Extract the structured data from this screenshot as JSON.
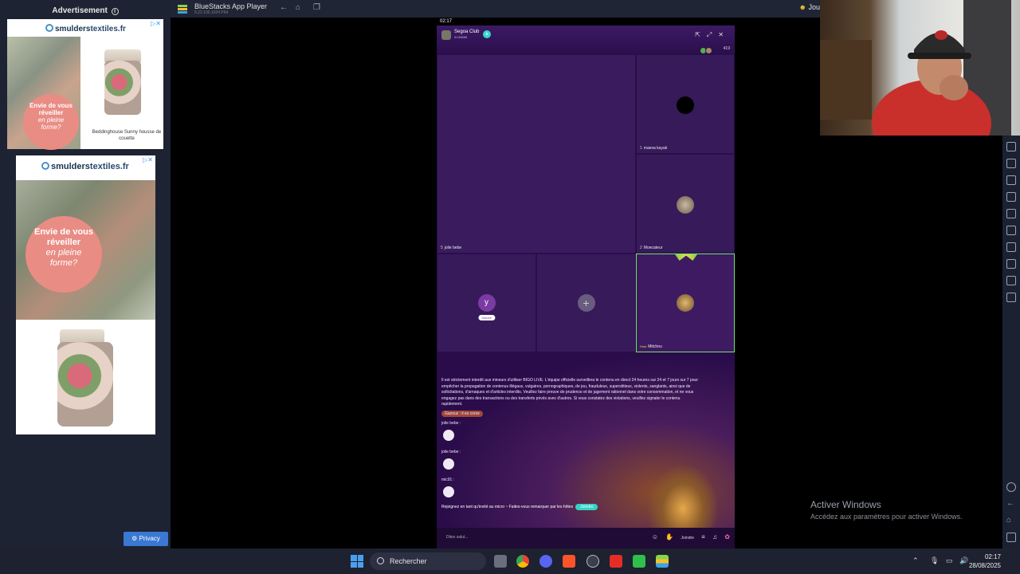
{
  "ads": {
    "title": "Advertisement",
    "ad1": {
      "brand_prefix": "smulders",
      "brand_suffix": "textiles.fr",
      "bubble_line1": "Envie de vous",
      "bubble_line2": "réveiller",
      "bubble_line3": "en pleine",
      "bubble_line4": "forme?",
      "caption": "Beddinghouse Sunny housse de couette"
    },
    "ad2": {
      "brand_prefix": "smulders",
      "brand_suffix": "textiles.fr",
      "bubble_line1": "Envie de vous",
      "bubble_line2": "réveiller",
      "bubble_line3": "en pleine",
      "bubble_line4": "forme?"
    },
    "privacy_label": "Privacy"
  },
  "bluestacks": {
    "title": "BlueStacks App Player",
    "version": "5.22.100.1024 P64",
    "join_label": "Jou"
  },
  "phone": {
    "status_time": "02:17",
    "club_name": "Segoa Club",
    "club_sub": "ID:88888",
    "online_count": "419",
    "seats": [
      {
        "num": "1",
        "name": "maeva kayak"
      },
      {
        "num": "2",
        "name": "Moecateur"
      },
      {
        "num": "5",
        "name": "jolie bebe"
      },
      {
        "num": "",
        "name": "Mitchou",
        "tag": "Host"
      }
    ],
    "y_avatar": "y",
    "y_badge": "Joindre",
    "notice": "Il est strictement interdit aux mineurs d'utiliser BIGO LIVE. L'équipe officielle surveillera le contenu en direct 24 heures sur 24 et 7 jours sur 7 pour empêcher la propagation de contenus illégaux, vulgaires, pornographiques, de jeu, frauduleux, superstitieux, violents, sanglants, ainsi que de sollicitations, d'arnaques et d'articles interdits. Veuillez faire preuve de prudence et de jugement rationnel dans votre consommation, et ne vous engagez pas dans des transactions ou des transferts privés avec d'autres. Si vous constatez des violations, veuillez signaler le contenu rapidement.",
    "messages": [
      {
        "user": "Gazouz",
        "text": "Gazouz : il es corse"
      },
      {
        "user": "jolie bebe",
        "text": "jolie bebe :"
      },
      {
        "user": "jolie bebe",
        "text": "jolie bebe :"
      },
      {
        "user": "mic91",
        "text": "mic91 :"
      }
    ],
    "invite_text": "Rejoignez en tant qu'invité au micro ~ Faites-vous remarquer par les hôtes",
    "invite_button": "Joindre",
    "say_hi": "Dites salut...",
    "join_label": "Joindre"
  },
  "watermark": {
    "title": "Activer Windows",
    "subtitle": "Accédez aux paramètres pour activer Windows."
  },
  "taskbar": {
    "search_label": "Rechercher",
    "time": "02:17",
    "date": "28/08/2025"
  }
}
